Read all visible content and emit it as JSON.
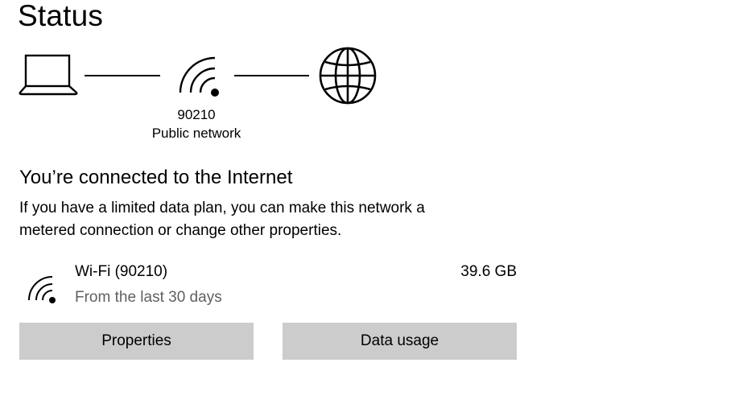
{
  "page": {
    "title": "Status"
  },
  "network_diagram": {
    "devices": [
      {
        "icon": "laptop-icon"
      },
      {
        "icon": "wifi-icon"
      },
      {
        "icon": "globe-icon"
      }
    ],
    "network_name": "90210",
    "network_type": "Public network"
  },
  "status": {
    "heading": "You’re connected to the Internet",
    "description_line1": "If you have a limited data plan, you can make this network a",
    "description_line2": "metered connection or change other properties."
  },
  "connection": {
    "icon": "wifi-icon",
    "name": "Wi-Fi (90210)",
    "period": "From the last 30 days",
    "usage": "39.6 GB"
  },
  "buttons": {
    "properties_label": "Properties",
    "data_usage_label": "Data usage"
  },
  "colors": {
    "button_bg": "#cccccc",
    "secondary_text": "#606060",
    "foreground": "#000000"
  }
}
